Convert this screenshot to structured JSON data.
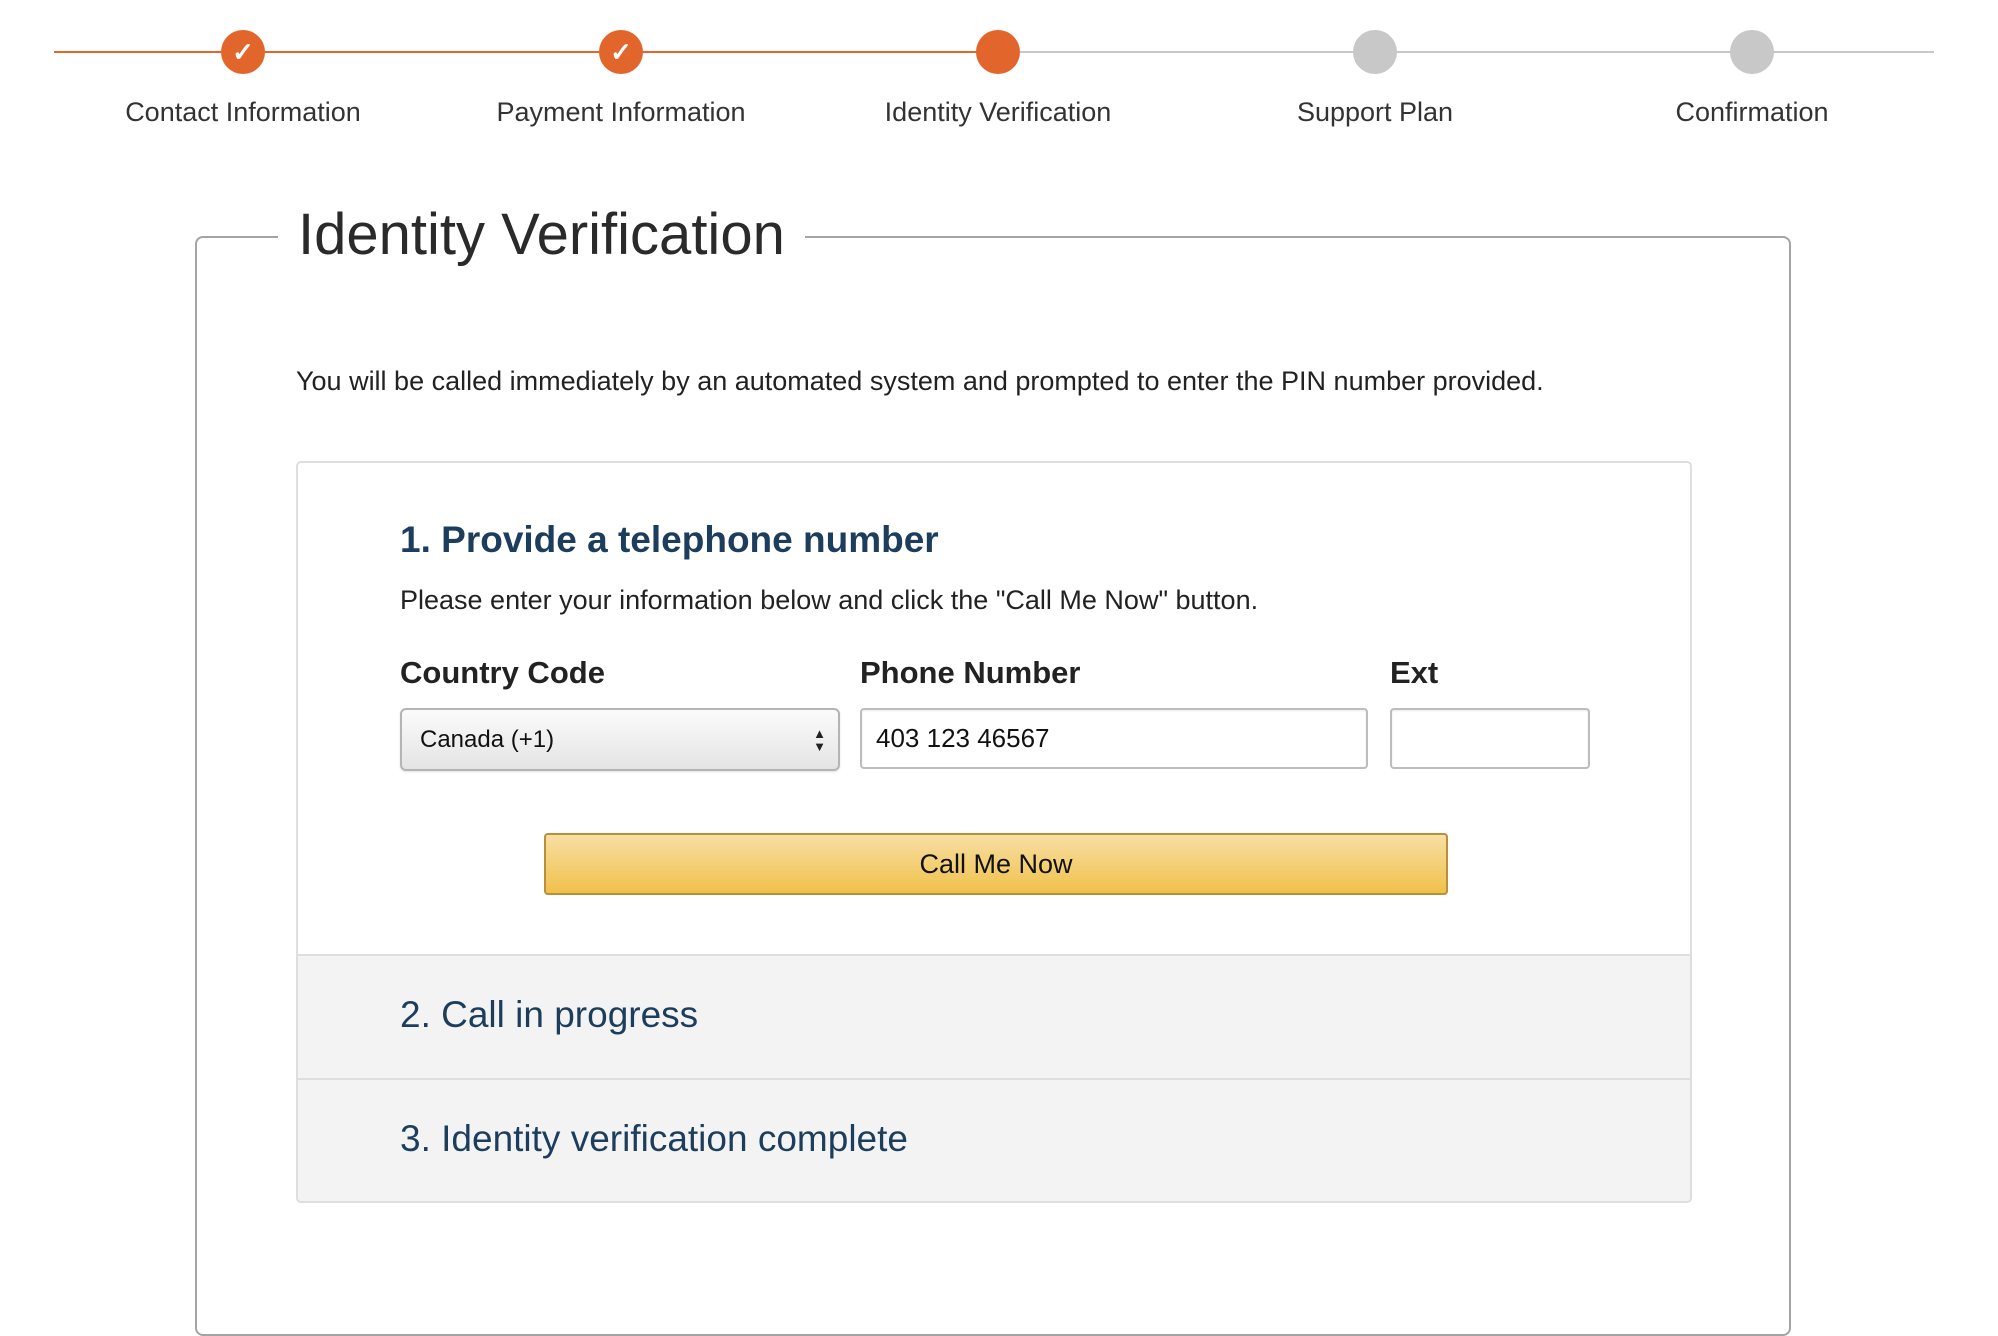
{
  "stepper": {
    "accent_color": "#e2662b",
    "pending_color": "#c8c8c8",
    "check_symbol": "✓",
    "steps": [
      {
        "label": "Contact Information",
        "state": "complete"
      },
      {
        "label": "Payment Information",
        "state": "complete"
      },
      {
        "label": "Identity Verification",
        "state": "current"
      },
      {
        "label": "Support Plan",
        "state": "pending"
      },
      {
        "label": "Confirmation",
        "state": "pending"
      }
    ]
  },
  "page": {
    "title": "Identity Verification",
    "intro": "You will be called immediately by an automated system and prompted to enter the PIN number provided."
  },
  "sections": {
    "provide_phone": {
      "title": "1. Provide a telephone number",
      "description": "Please enter your information below and click the \"Call Me Now\" button.",
      "country_code_label": "Country Code",
      "country_code_value": "Canada (+1)",
      "phone_label": "Phone Number",
      "phone_value": "403 123 46567",
      "ext_label": "Ext",
      "ext_value": "",
      "call_button_label": "Call Me Now",
      "button_color": "#f0c14b"
    },
    "call_in_progress": {
      "title": "2. Call in progress"
    },
    "verification_complete": {
      "title": "3. Identity verification complete"
    }
  }
}
